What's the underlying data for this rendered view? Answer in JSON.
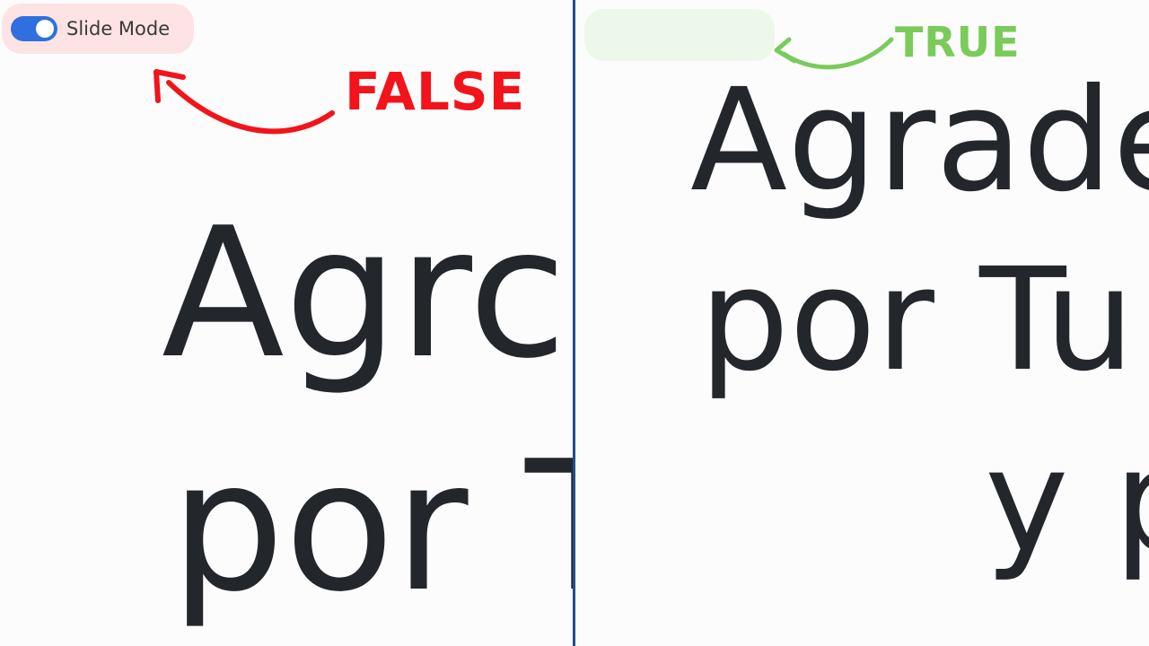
{
  "false_panel": {
    "toggle": {
      "label": "Slide Mode",
      "on": true,
      "icon": "toggle-switch-icon"
    },
    "annotation": "FALSE",
    "annotation_color": "#f2141a",
    "content": {
      "line1": "Agrc",
      "line2": "por T"
    }
  },
  "true_panel": {
    "annotation": "TRUE",
    "annotation_color": "#7acb5a",
    "content": {
      "line1": "Agrade",
      "line2": "por Tu",
      "line3": "y p"
    }
  },
  "colors": {
    "divider": "#1f4e8c",
    "text": "#23262b",
    "toggle_track": "#2f6fe0",
    "pill_false": "#fde3e3",
    "pill_true": "#eef8ea"
  }
}
